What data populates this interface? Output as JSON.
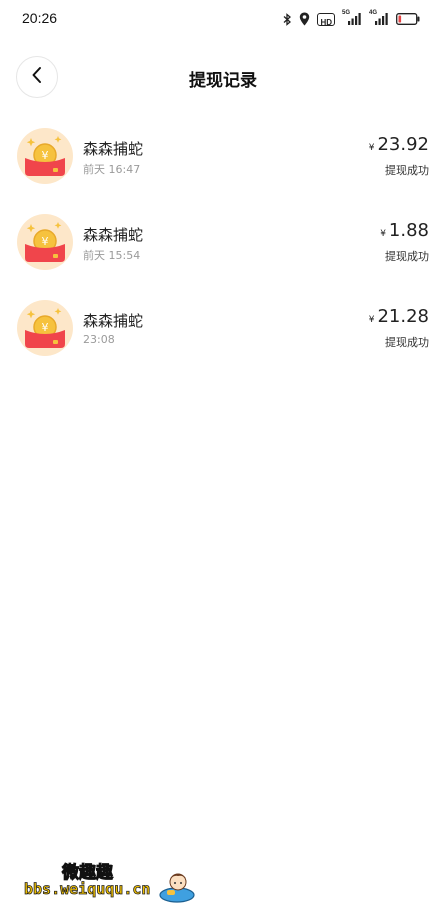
{
  "status_bar": {
    "time": "20:26",
    "icons": [
      "bluetooth-icon",
      "location-icon",
      "hd-icon",
      "signal-5g-icon",
      "signal-4g-icon",
      "battery-low-icon"
    ],
    "hd_label": "HD",
    "signal_labels": [
      "5G",
      "4G"
    ],
    "battery_color": "#e64545"
  },
  "header": {
    "back_icon": "chevron-left-icon",
    "title": "提现记录"
  },
  "records": [
    {
      "name": "森森捕蛇",
      "time": "前天 16:47",
      "currency": "¥",
      "amount": "23.92",
      "status": "提现成功"
    },
    {
      "name": "森森捕蛇",
      "time": "前天 15:54",
      "currency": "¥",
      "amount": "1.88",
      "status": "提现成功"
    },
    {
      "name": "森森捕蛇",
      "time": "23:08",
      "currency": "¥",
      "amount": "21.28",
      "status": "提现成功"
    }
  ],
  "watermark": {
    "title": "微趣趣",
    "url": "bbs.weiququ.cn",
    "mascot_icon": "mascot-icon"
  },
  "colors": {
    "avatar_bg": "#fde7c9",
    "envelope_red": "#f0454b",
    "coin_gold": "#f6c23e"
  }
}
